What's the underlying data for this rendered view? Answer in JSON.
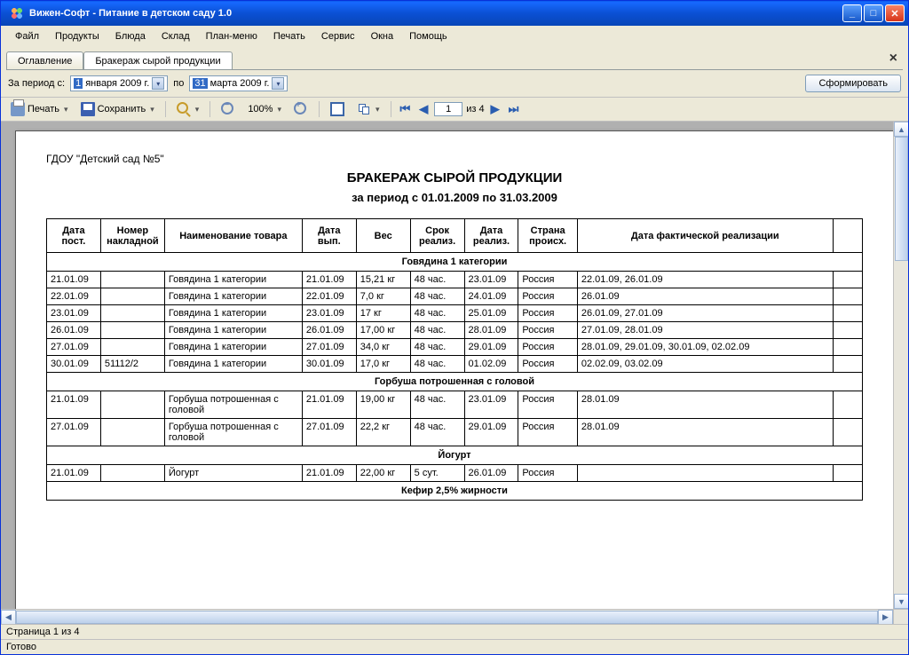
{
  "window": {
    "title": "Вижен-Софт - Питание в детском саду 1.0"
  },
  "menu": {
    "file": "Файл",
    "products": "Продукты",
    "dishes": "Блюда",
    "stock": "Склад",
    "plan": "План-меню",
    "print": "Печать",
    "service": "Сервис",
    "windows": "Окна",
    "help": "Помощь"
  },
  "tabs": {
    "toc": "Оглавление",
    "active": "Бракераж сырой продукции"
  },
  "filter": {
    "label_from": "За период с:",
    "date_from_day": "1",
    "date_from_month": "января",
    "date_from_year": "2009 г.",
    "label_to": "по",
    "date_to_day": "31",
    "date_to_month": "марта",
    "date_to_year": "2009 г.",
    "generate": "Сформировать"
  },
  "toolbar": {
    "print": "Печать",
    "save": "Сохранить",
    "zoom_value": "100%",
    "page_current": "1",
    "page_sep": "из 4"
  },
  "report": {
    "org": "ГДОУ \"Детский сад №5\"",
    "title": "БРАКЕРАЖ СЫРОЙ ПРОДУКЦИИ",
    "subtitle": "за период с 01.01.2009 по 31.03.2009",
    "headers": {
      "c1": "Дата пост.",
      "c2": "Номер накладной",
      "c3": "Наименование товара",
      "c4": "Дата вып.",
      "c5": "Вес",
      "c6": "Срок реализ.",
      "c7": "Дата реализ.",
      "c8": "Страна происх.",
      "c9": "Дата фактической реализации"
    },
    "groups": [
      {
        "name": "Говядина 1 категории",
        "rows": [
          {
            "c1": "21.01.09",
            "c2": "",
            "c3": "Говядина 1 категории",
            "c4": "21.01.09",
            "c5": "15,21 кг",
            "c6": "48 час.",
            "c7": "23.01.09",
            "c8": "Россия",
            "c9": "22.01.09, 26.01.09"
          },
          {
            "c1": "22.01.09",
            "c2": "",
            "c3": "Говядина 1 категории",
            "c4": "22.01.09",
            "c5": "7,0 кг",
            "c6": "48 час.",
            "c7": "24.01.09",
            "c8": "Россия",
            "c9": "26.01.09"
          },
          {
            "c1": "23.01.09",
            "c2": "",
            "c3": "Говядина 1 категории",
            "c4": "23.01.09",
            "c5": "17 кг",
            "c6": "48 час.",
            "c7": "25.01.09",
            "c8": "Россия",
            "c9": "26.01.09, 27.01.09"
          },
          {
            "c1": "26.01.09",
            "c2": "",
            "c3": "Говядина 1 категории",
            "c4": "26.01.09",
            "c5": "17,00 кг",
            "c6": "48 час.",
            "c7": "28.01.09",
            "c8": "Россия",
            "c9": "27.01.09, 28.01.09"
          },
          {
            "c1": "27.01.09",
            "c2": "",
            "c3": "Говядина 1 категории",
            "c4": "27.01.09",
            "c5": "34,0 кг",
            "c6": "48 час.",
            "c7": "29.01.09",
            "c8": "Россия",
            "c9": "28.01.09, 29.01.09, 30.01.09, 02.02.09"
          },
          {
            "c1": "30.01.09",
            "c2": "51112/2",
            "c3": "Говядина 1 категории",
            "c4": "30.01.09",
            "c5": "17,0 кг",
            "c6": "48 час.",
            "c7": "01.02.09",
            "c8": "Россия",
            "c9": "02.02.09, 03.02.09"
          }
        ]
      },
      {
        "name": "Горбуша потрошенная с головой",
        "rows": [
          {
            "c1": "21.01.09",
            "c2": "",
            "c3": "Горбуша потрошенная с головой",
            "c4": "21.01.09",
            "c5": "19,00 кг",
            "c6": "48 час.",
            "c7": "23.01.09",
            "c8": "Россия",
            "c9": "28.01.09"
          },
          {
            "c1": "27.01.09",
            "c2": "",
            "c3": "Горбуша потрошенная с головой",
            "c4": "27.01.09",
            "c5": "22,2 кг",
            "c6": "48 час.",
            "c7": "29.01.09",
            "c8": "Россия",
            "c9": "28.01.09"
          }
        ]
      },
      {
        "name": "Йогурт",
        "rows": [
          {
            "c1": "21.01.09",
            "c2": "",
            "c3": "Йогурт",
            "c4": "21.01.09",
            "c5": "22,00 кг",
            "c6": "5 сут.",
            "c7": "26.01.09",
            "c8": "Россия",
            "c9": ""
          }
        ]
      },
      {
        "name": "Кефир 2,5% жирности",
        "rows": []
      }
    ]
  },
  "status": {
    "page": "Страница 1 из 4",
    "ready": "Готово"
  }
}
